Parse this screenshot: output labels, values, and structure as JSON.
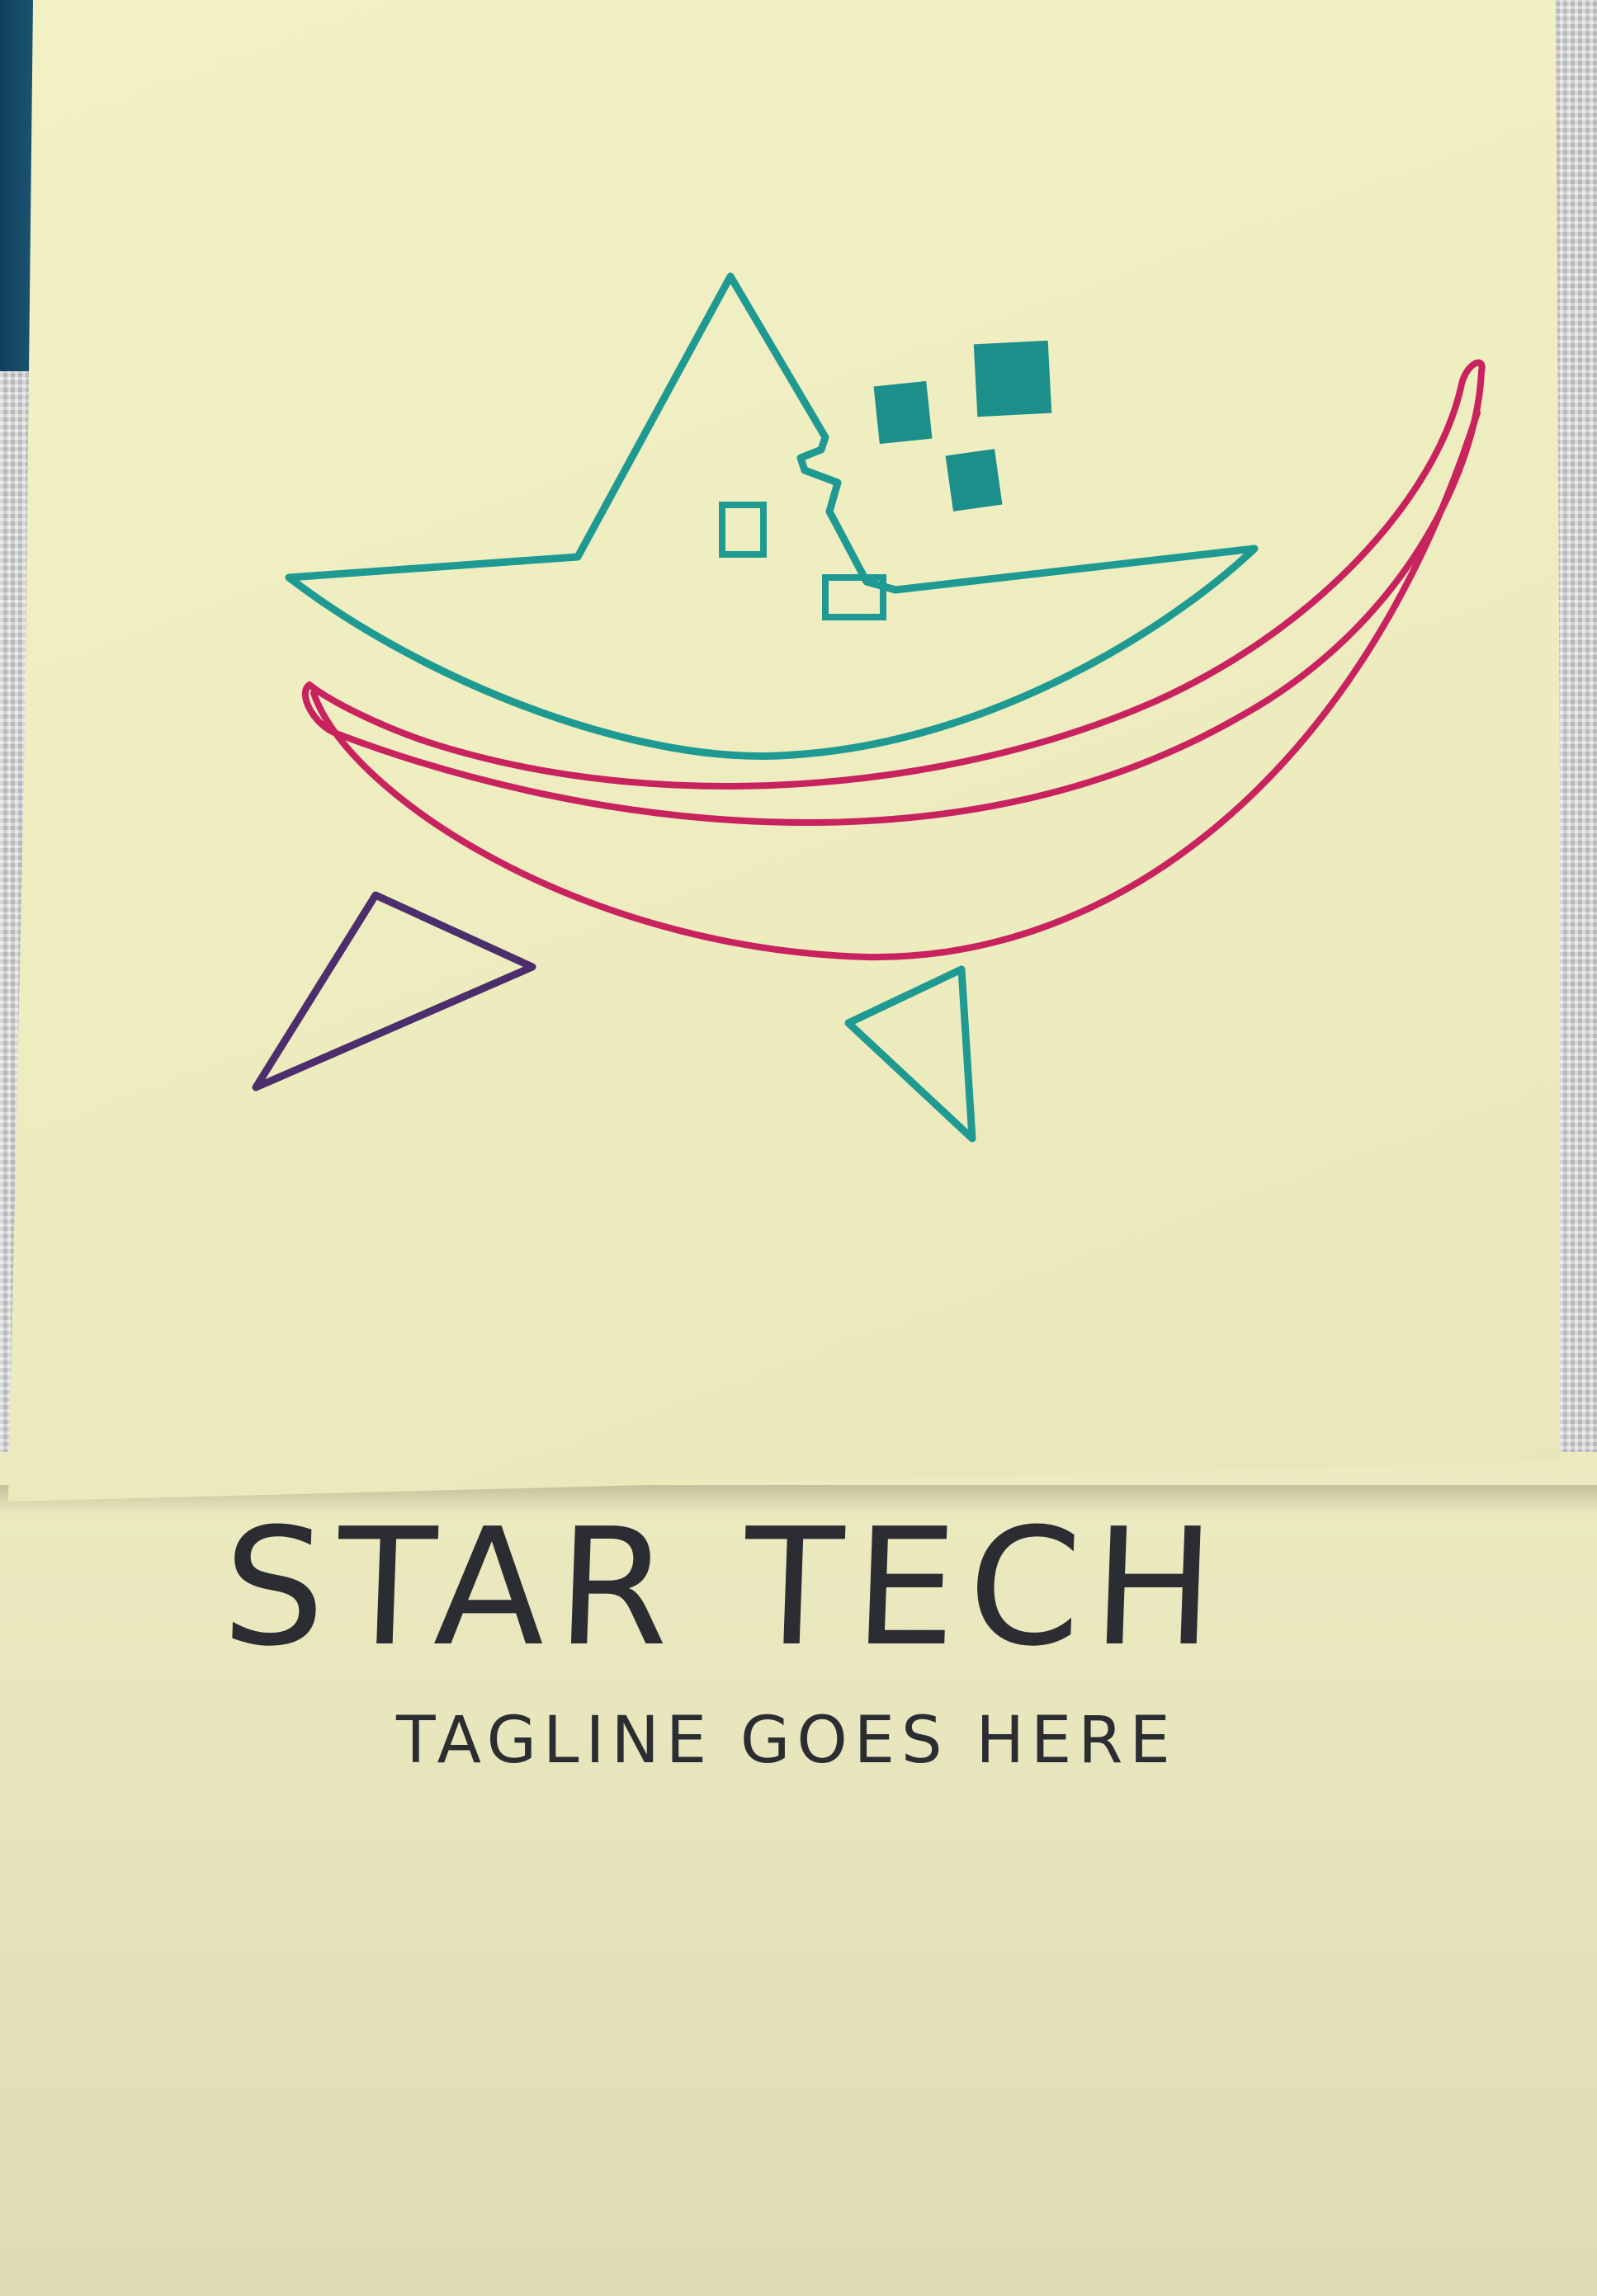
{
  "sketch": {
    "brand_name": "STAR TECH",
    "tagline": "TAGLINE GOES HERE"
  },
  "colors": {
    "note": "#eeedc0",
    "teal_marker": "#1f9a93",
    "magenta_marker": "#c8225f",
    "purple_marker": "#4b2e6b",
    "ink": "#2b2d33",
    "blue_tab": "#154a68"
  }
}
